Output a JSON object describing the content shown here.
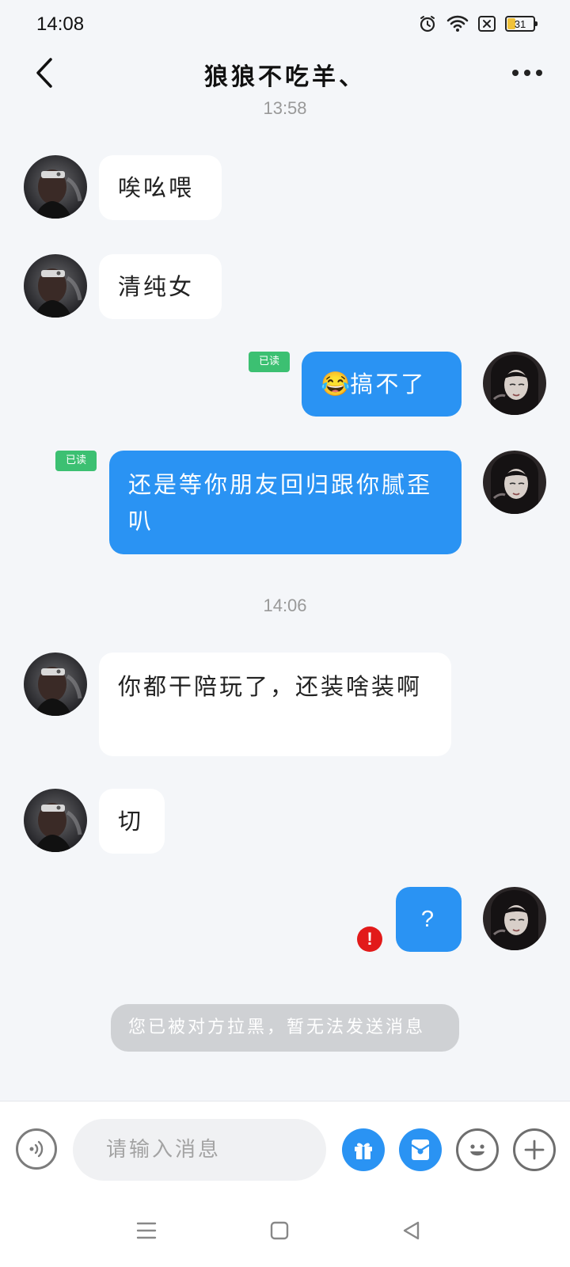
{
  "status_bar": {
    "time": "14:08",
    "battery": "31"
  },
  "header": {
    "title": "狼狼不吃羊、"
  },
  "messages": {
    "ts1": "13:58",
    "m1": "唉吆喂",
    "m2": "清纯女",
    "m3_emoji": "😂",
    "m3": "搞不了",
    "m4": "还是等你朋友回归跟你腻歪叭",
    "ts2": "14:06",
    "m5": "你都干陪玩了，还装啥装啊",
    "m6": "切",
    "m7": "?",
    "read_label": "已读",
    "error_mark": "!",
    "system_notice": "您已被对方拉黑，暂无法发送消息"
  },
  "input": {
    "placeholder": "请输入消息"
  },
  "colors": {
    "accent": "#2a93f3",
    "read_badge": "#3cc072",
    "error": "#e21a1a",
    "background": "#f4f6f9"
  },
  "icons": [
    "alarm-icon",
    "wifi-icon",
    "sim-off-icon",
    "battery-icon",
    "back-icon",
    "more-icon",
    "voice-icon",
    "gift-icon",
    "red-packet-icon",
    "emoji-icon",
    "plus-icon",
    "menu-nav-icon",
    "home-nav-icon",
    "back-nav-icon"
  ]
}
